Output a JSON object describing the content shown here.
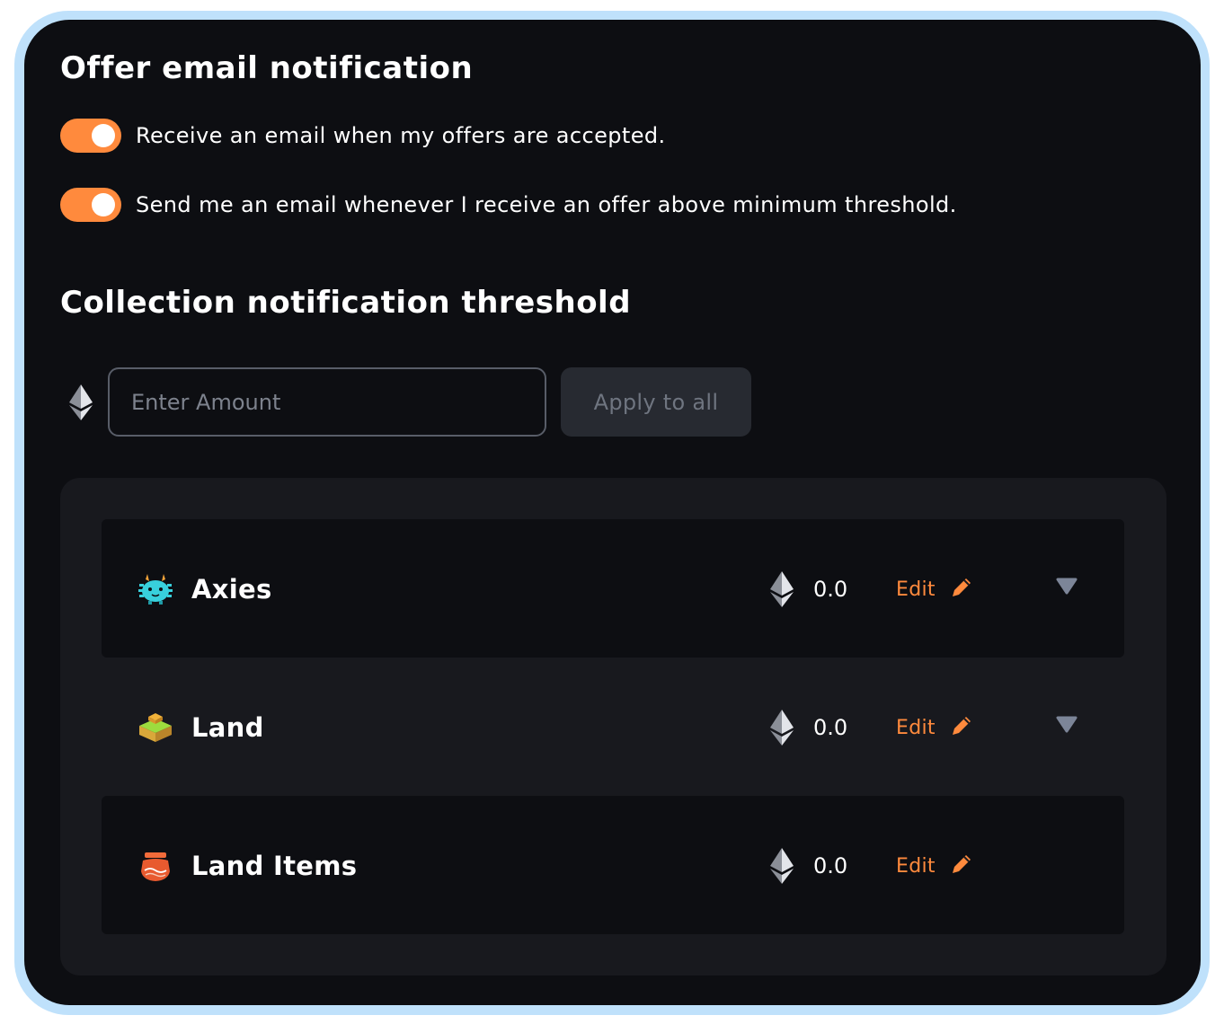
{
  "offer_notifications": {
    "title": "Offer email notification",
    "toggles": [
      {
        "label": "Receive an email when my offers are accepted.",
        "enabled": true
      },
      {
        "label": "Send me an email whenever I receive an offer above minimum threshold.",
        "enabled": true
      }
    ]
  },
  "threshold": {
    "title": "Collection notification threshold",
    "currency_icon": "ethereum-icon",
    "amount_placeholder": "Enter Amount",
    "amount_value": "",
    "apply_label": "Apply to all"
  },
  "collections": [
    {
      "name": "Axies",
      "icon": "axie-icon",
      "value": "0.0",
      "edit_label": "Edit",
      "expandable": true
    },
    {
      "name": "Land",
      "icon": "land-icon",
      "value": "0.0",
      "edit_label": "Edit",
      "expandable": true
    },
    {
      "name": "Land Items",
      "icon": "land-items-icon",
      "value": "0.0",
      "edit_label": "Edit",
      "expandable": false
    }
  ],
  "colors": {
    "accent": "#ff8a3d",
    "background": "#0d0e12",
    "list_background": "#18191e",
    "frame": "#bfe1fb"
  }
}
